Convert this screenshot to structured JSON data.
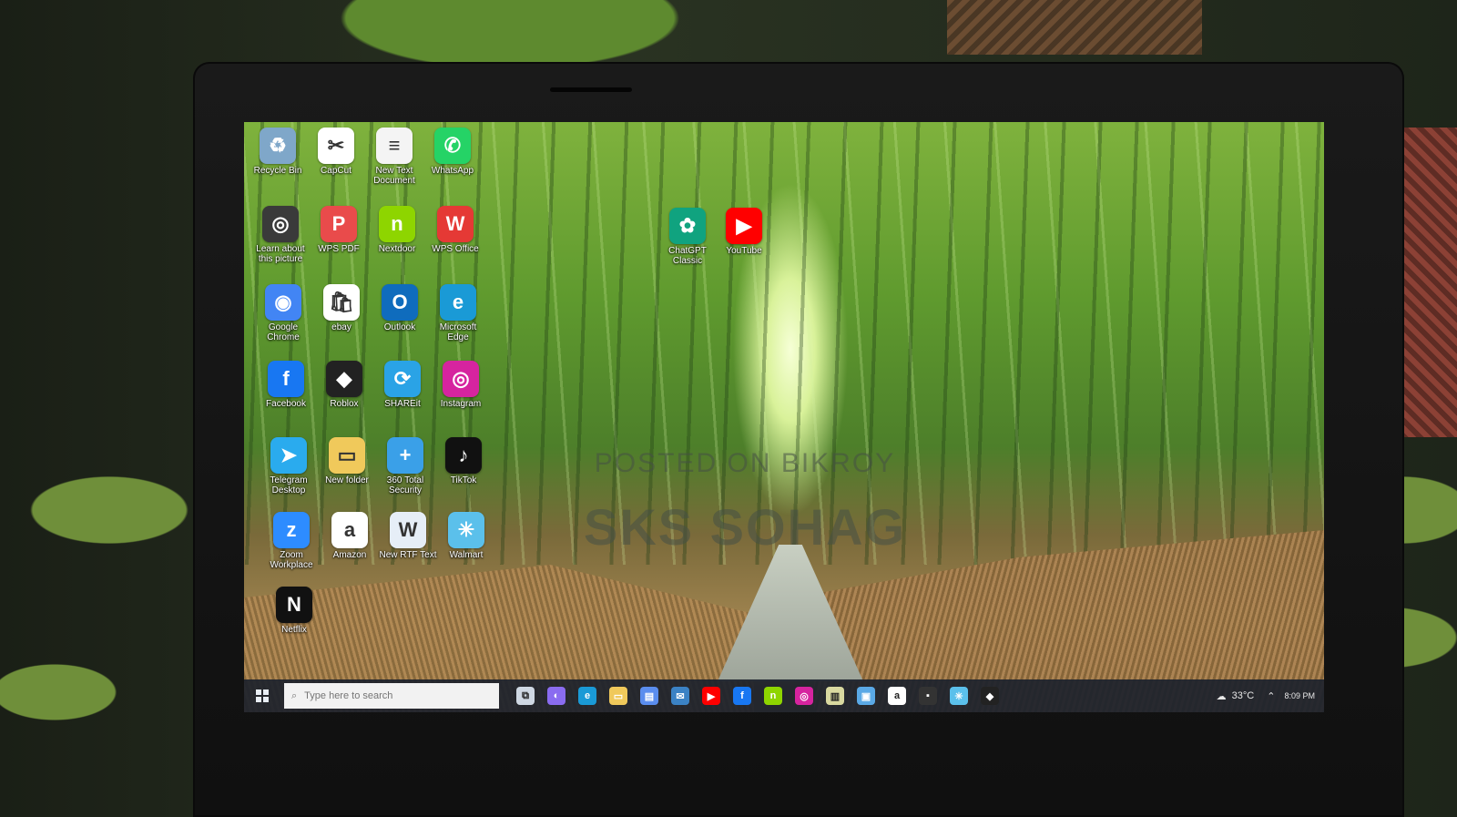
{
  "desktop": {
    "watermark": {
      "line1": "POSTED ON BIKROY",
      "line2": "SKS SOHAG"
    },
    "icons": [
      {
        "label": "Recycle Bin",
        "icon": "recycle-bin-icon",
        "color": "#7fa7c9",
        "glyph": "♻"
      },
      {
        "label": "CapCut",
        "icon": "capcut-icon",
        "color": "#ffffff",
        "glyph": "✂"
      },
      {
        "label": "New Text Document",
        "icon": "text-document-icon",
        "color": "#f4f4f4",
        "glyph": "≡"
      },
      {
        "label": "WhatsApp",
        "icon": "whatsapp-icon",
        "color": "#25d366",
        "glyph": "✆"
      },
      {
        "label": "Learn about this picture",
        "icon": "learn-picture-icon",
        "color": "#3a3a3a",
        "glyph": "◎"
      },
      {
        "label": "WPS PDF",
        "icon": "wps-pdf-icon",
        "color": "#e94b4b",
        "glyph": "P"
      },
      {
        "label": "Nextdoor",
        "icon": "nextdoor-icon",
        "color": "#8ed500",
        "glyph": "n"
      },
      {
        "label": "WPS Office",
        "icon": "wps-office-icon",
        "color": "#e53935",
        "glyph": "W"
      },
      {
        "label": "Google Chrome",
        "icon": "chrome-icon",
        "color": "#4285f4",
        "glyph": "◉"
      },
      {
        "label": "ebay",
        "icon": "ebay-icon",
        "color": "#ffffff",
        "glyph": "🛍"
      },
      {
        "label": "Outlook",
        "icon": "outlook-icon",
        "color": "#0f6cbd",
        "glyph": "O"
      },
      {
        "label": "Microsoft Edge",
        "icon": "edge-icon",
        "color": "#1a9ad6",
        "glyph": "e"
      },
      {
        "label": "Facebook",
        "icon": "facebook-icon",
        "color": "#1877f2",
        "glyph": "f"
      },
      {
        "label": "Roblox",
        "icon": "roblox-icon",
        "color": "#222222",
        "glyph": "◆"
      },
      {
        "label": "SHAREit",
        "icon": "shareit-icon",
        "color": "#2aa3e6",
        "glyph": "⟳"
      },
      {
        "label": "Instagram",
        "icon": "instagram-icon",
        "color": "#d6249f",
        "glyph": "◎"
      },
      {
        "label": "Telegram Desktop",
        "icon": "telegram-icon",
        "color": "#2aabee",
        "glyph": "➤"
      },
      {
        "label": "New folder",
        "icon": "folder-icon",
        "color": "#f0c95b",
        "glyph": "▭"
      },
      {
        "label": "360 Total Security",
        "icon": "security-360-icon",
        "color": "#3aa0e8",
        "glyph": "+"
      },
      {
        "label": "TikTok",
        "icon": "tiktok-icon",
        "color": "#111111",
        "glyph": "♪"
      },
      {
        "label": "Zoom Workplace",
        "icon": "zoom-icon",
        "color": "#2d8cff",
        "glyph": "z"
      },
      {
        "label": "Amazon",
        "icon": "amazon-icon",
        "color": "#ffffff",
        "glyph": "a"
      },
      {
        "label": "New RTF Text",
        "icon": "rtf-document-icon",
        "color": "#e6eef7",
        "glyph": "W"
      },
      {
        "label": "Walmart",
        "icon": "walmart-icon",
        "color": "#5bc0eb",
        "glyph": "✳"
      },
      {
        "label": "Netflix",
        "icon": "netflix-icon",
        "color": "#111111",
        "glyph": "N"
      },
      {
        "label": "ChatGPT Classic",
        "icon": "chatgpt-icon",
        "color": "#10a37f",
        "glyph": "✿"
      },
      {
        "label": "YouTube",
        "icon": "youtube-icon",
        "color": "#ff0000",
        "glyph": "▶"
      }
    ]
  },
  "taskbar": {
    "search_placeholder": "Type here to search",
    "weather_temp": "33°C",
    "clock_time": "8:09 PM",
    "pinned": [
      {
        "icon": "task-view-icon",
        "color": "#cfd8e3",
        "glyph": "⧉"
      },
      {
        "icon": "copilot-icon",
        "color": "#8a6cf0",
        "glyph": "◐"
      },
      {
        "icon": "edge-icon",
        "color": "#1a9ad6",
        "glyph": "e"
      },
      {
        "icon": "file-explorer-icon",
        "color": "#f0c95b",
        "glyph": "▭"
      },
      {
        "icon": "store-icon",
        "color": "#5a8dee",
        "glyph": "▤"
      },
      {
        "icon": "mail-icon",
        "color": "#3b82c4",
        "glyph": "✉"
      },
      {
        "icon": "youtube-icon",
        "color": "#ff0000",
        "glyph": "▶"
      },
      {
        "icon": "facebook-icon",
        "color": "#1877f2",
        "glyph": "f"
      },
      {
        "icon": "nextdoor-icon",
        "color": "#8ed500",
        "glyph": "n"
      },
      {
        "icon": "instagram-icon",
        "color": "#d6249f",
        "glyph": "◎"
      },
      {
        "icon": "notes-icon",
        "color": "#d9d9a0",
        "glyph": "▥"
      },
      {
        "icon": "photos-icon",
        "color": "#5aa9e6",
        "glyph": "▣"
      },
      {
        "icon": "amazon-icon",
        "color": "#ffffff",
        "glyph": "a"
      },
      {
        "icon": "app-dark-icon",
        "color": "#333333",
        "glyph": "▪"
      },
      {
        "icon": "walmart-icon",
        "color": "#5bc0eb",
        "glyph": "✳"
      },
      {
        "icon": "roblox-icon",
        "color": "#222222",
        "glyph": "◆"
      }
    ]
  }
}
